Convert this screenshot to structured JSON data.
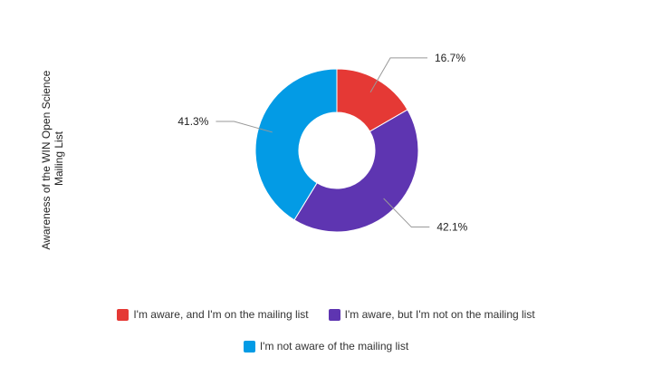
{
  "chart_data": {
    "type": "pie",
    "style": "donut",
    "ylabel": "Awareness of the WIN Open Science Mailing List",
    "ylabel_lines": [
      "Awareness of the WIN Open Science",
      "Mailing List"
    ],
    "legend_position": "bottom",
    "series": [
      {
        "name": "I'm aware, and I'm on the mailing list",
        "value": 16.7,
        "label": "16.7%",
        "color": "#e53935"
      },
      {
        "name": "I'm aware, but I'm not on the mailing list",
        "value": 42.1,
        "label": "42.1%",
        "color": "#5e35b1"
      },
      {
        "name": "I'm not aware of the mailing list",
        "value": 41.3,
        "label": "41.3%",
        "color": "#039be5"
      }
    ]
  }
}
